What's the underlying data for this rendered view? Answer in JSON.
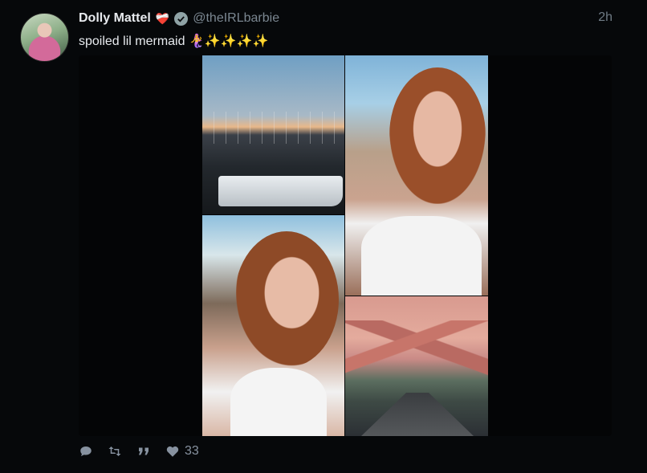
{
  "post": {
    "display_name": "Dolly Mattel",
    "name_emoji": "❤️‍🩹",
    "handle": "@theIRLbarbie",
    "time": "2h",
    "text": "spoiled lil mermaid 🧜‍♀️✨✨✨✨",
    "likes": "33",
    "verified": true
  },
  "media": [
    {
      "name": "marina-boats-photo"
    },
    {
      "name": "selfie-with-drink-photo"
    },
    {
      "name": "selfie-with-oyster-photo"
    },
    {
      "name": "mountain-highway-photo"
    }
  ],
  "icons": {
    "reply": "speech-bubble-icon",
    "repost": "repost-icon",
    "quote": "quote-icon",
    "like": "heart-icon"
  },
  "colors": {
    "background": "#06080a",
    "muted": "#8792a0",
    "name": "#e7eaee"
  }
}
